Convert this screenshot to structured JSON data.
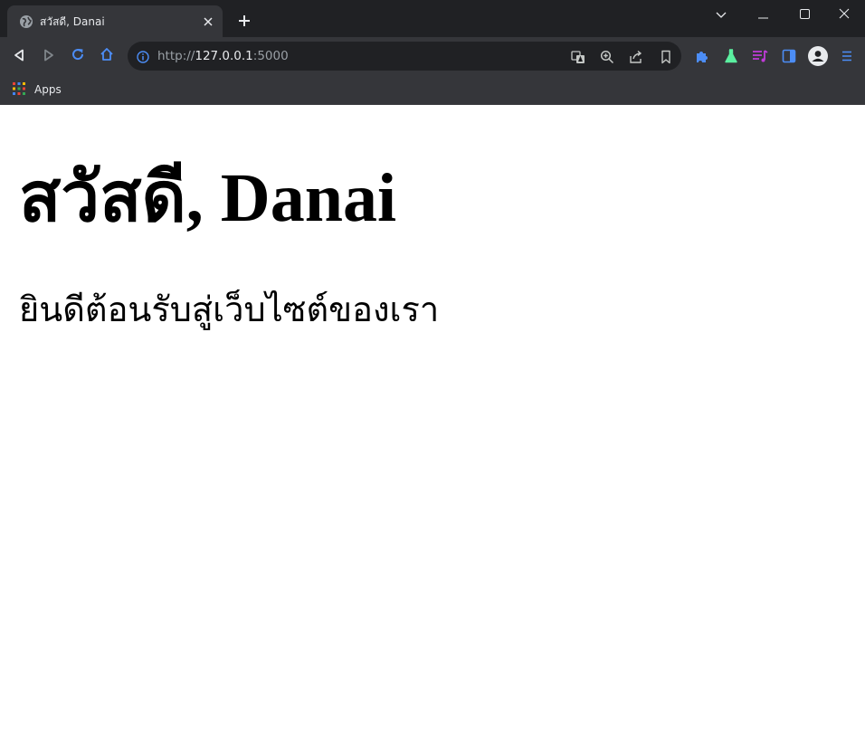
{
  "browser": {
    "tab": {
      "title": "สวัสดี, Danai"
    },
    "address_bar": {
      "scheme": "http://",
      "host": "127.0.0.1",
      "port": ":5000"
    },
    "bookmarks": {
      "apps_label": "Apps"
    },
    "icons": {
      "favicon": "globe-icon",
      "close": "close-icon",
      "new_tab": "plus-icon",
      "back": "back-icon",
      "forward": "forward-icon",
      "reload": "reload-icon",
      "home": "home-icon",
      "site_info": "info-icon",
      "translate": "translate-icon",
      "zoom": "zoom-icon",
      "share": "share-icon",
      "bookmark": "bookmark-icon",
      "extensions": "puzzle-icon",
      "labs": "flask-icon",
      "reading_list": "reading-list-icon",
      "side_panel": "side-panel-icon",
      "profile": "profile-icon",
      "menu": "menu-icon"
    },
    "colors": {
      "frame": "#202124",
      "toolbar": "#35363a",
      "accent": "#4c8df6",
      "labs": "#5bf0a0",
      "reading_list": "#c03bd8"
    }
  },
  "page": {
    "heading": "สวัสดี, Danai",
    "subtitle": "ยินดีต้อนรับสู่เว็บไซต์ของเรา"
  }
}
